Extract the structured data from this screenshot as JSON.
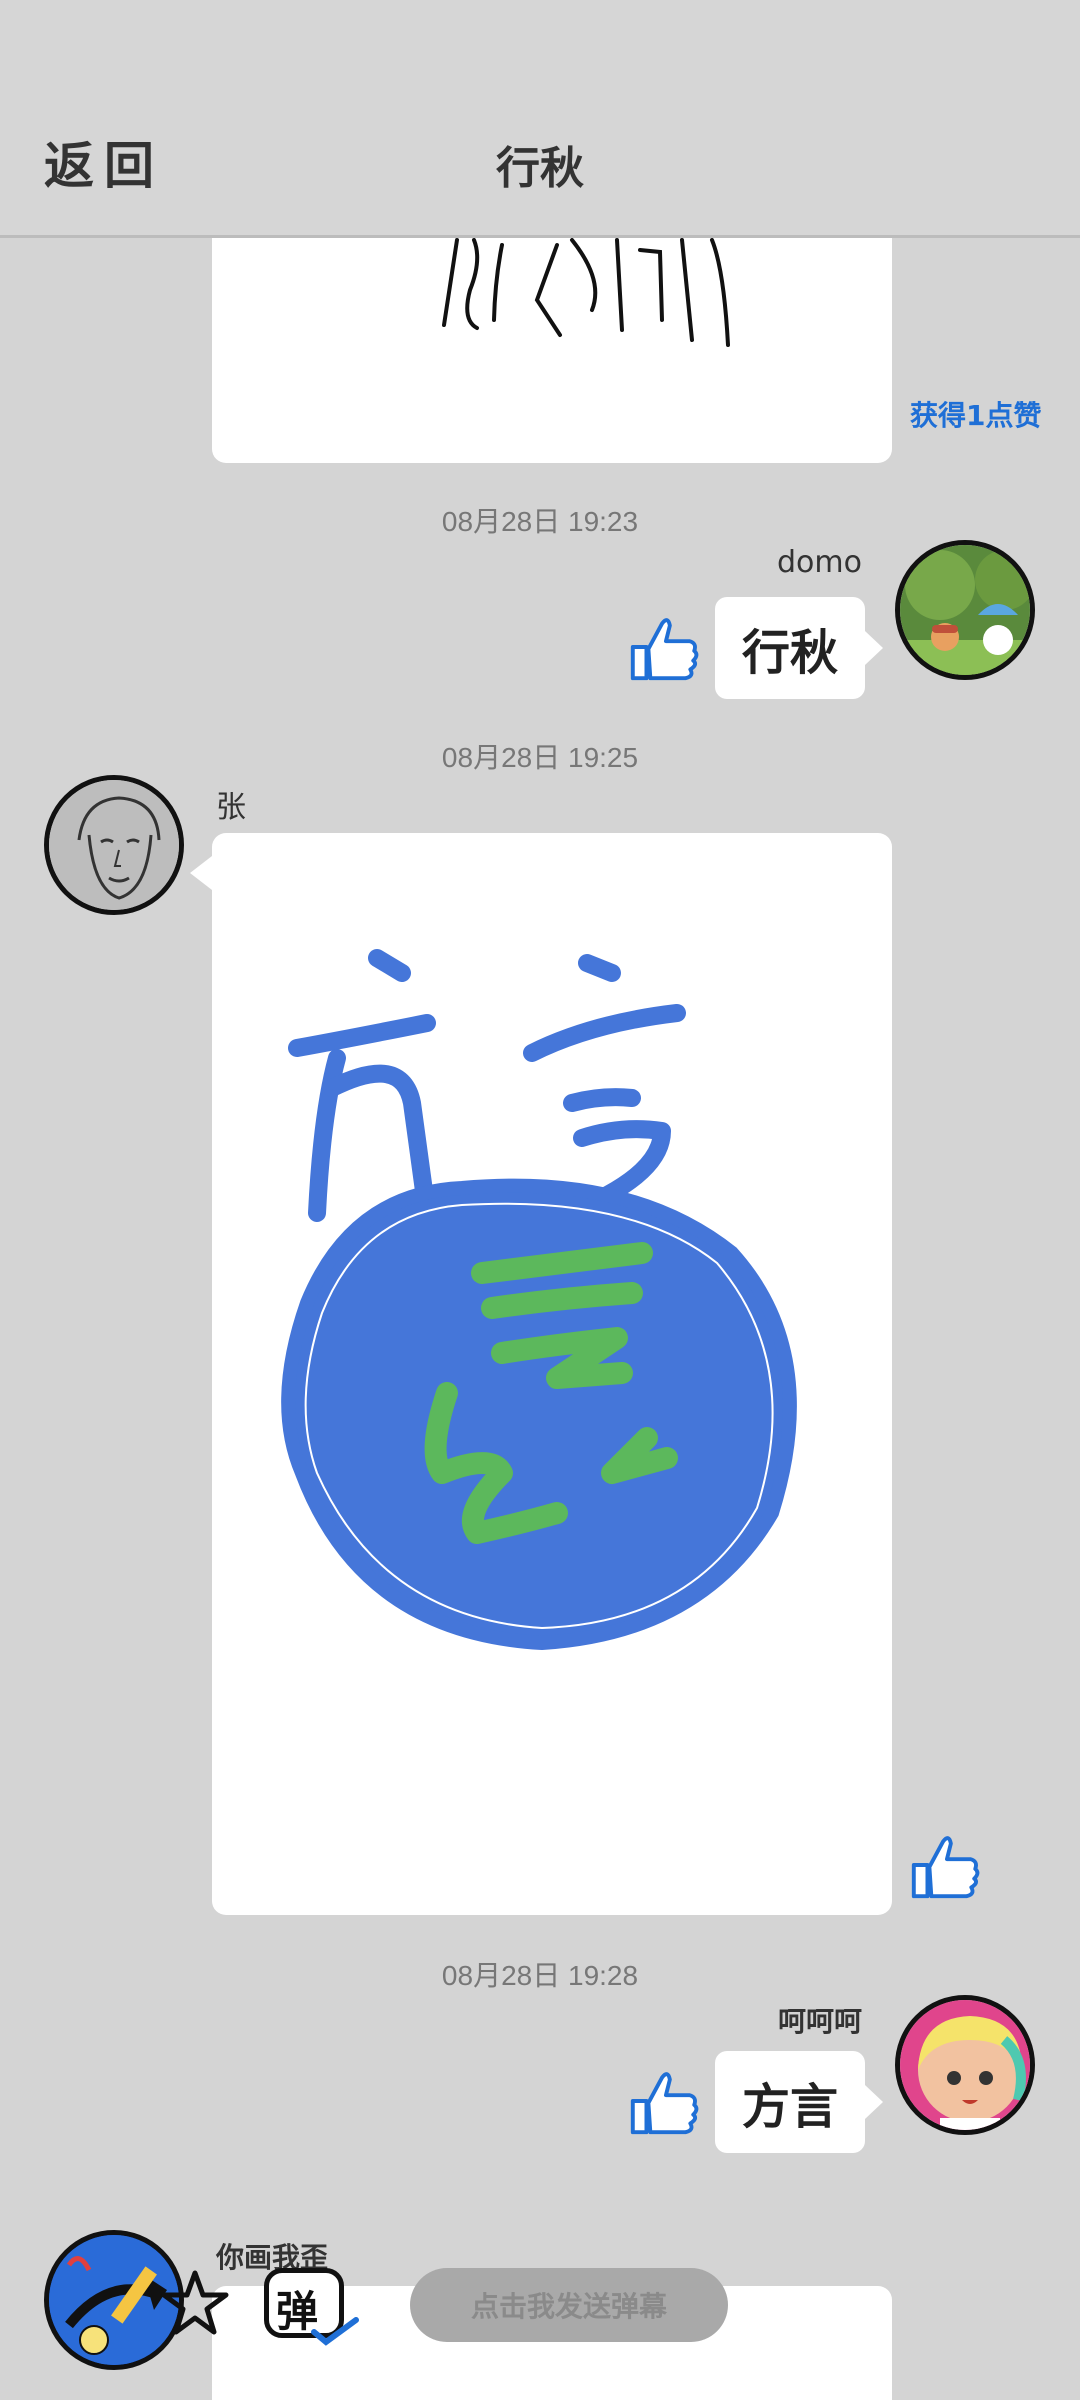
{
  "header": {
    "back_label": "返回",
    "title": "行秋"
  },
  "messages": [
    {
      "likes_text": "获得1点赞"
    },
    {
      "timestamp": "08月28日  19:23",
      "sender": "domo",
      "text": "行秋"
    },
    {
      "timestamp": "08月28日  19:25",
      "sender": "张"
    },
    {
      "timestamp": "08月28日  19:28",
      "sender": "呵呵呵",
      "text": "方言"
    },
    {
      "sender": "你画我歪"
    }
  ],
  "footer": {
    "star_icon": "star-icon",
    "danmaku_toggle_char": "弹",
    "danmaku_button": "点击我发送弹幕"
  },
  "colors": {
    "background": "#d4d4d4",
    "like_blue": "#1f6fd6",
    "drawing_blue": "#4576d9",
    "drawing_green": "#5cb85c"
  }
}
